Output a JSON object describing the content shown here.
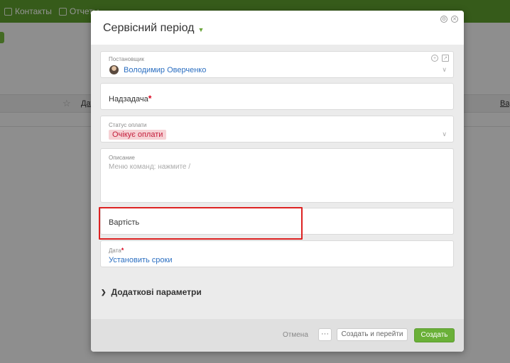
{
  "background": {
    "nav": {
      "contacts": "Контакты",
      "reports": "Отчеты"
    },
    "columns": {
      "left": "Дат",
      "right": "Вар"
    }
  },
  "modal": {
    "title": "Сервісний період",
    "assignee": {
      "label": "Постановщик",
      "name": "Володимир Оверченко"
    },
    "parent_task": {
      "label": "Надзадача",
      "required_mark": "*"
    },
    "payment_status": {
      "label": "Статус оплати",
      "value": "Очікує оплати"
    },
    "description": {
      "label": "Описание",
      "placeholder": "Меню команд: нажмите /"
    },
    "cost": {
      "label": "Вартість"
    },
    "date": {
      "label": "Дата",
      "required_mark": "*",
      "action": "Установить сроки"
    },
    "extra_params": "Додаткові параметри",
    "footer": {
      "cancel": "Отмена",
      "more": "···",
      "create_and_go": "Создать и перейти",
      "create": "Создать"
    }
  },
  "colors": {
    "accent": "#6ab038",
    "status_bg": "#f6d2d5",
    "status_text": "#c41d3b",
    "highlight": "#dd2222",
    "link": "#2c6fc1"
  }
}
